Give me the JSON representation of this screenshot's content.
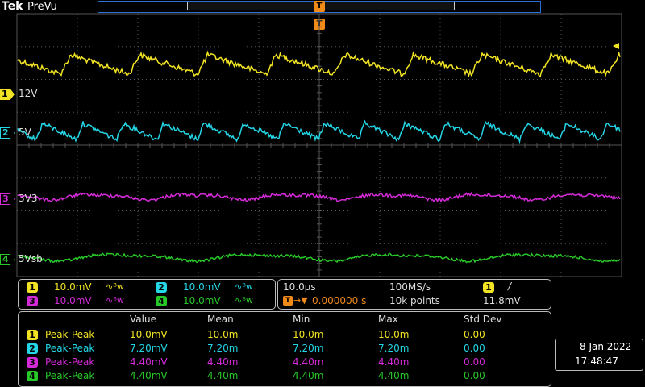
{
  "header": {
    "brand": "Tek",
    "mode": "PreVu",
    "trigger_marker": "T"
  },
  "colors": {
    "ch1": "#f2e424",
    "ch2": "#24d6e6",
    "ch3": "#d42ad8",
    "ch4": "#28c828",
    "trigger": "#f08a18",
    "grid": "#555555"
  },
  "channels": [
    {
      "num": "1",
      "label": "12V",
      "scale": "10.0mV",
      "coupling_icon": "ac-bandwidth-icon"
    },
    {
      "num": "2",
      "label": "5V",
      "scale": "10.0mV",
      "coupling_icon": "ac-bandwidth-icon"
    },
    {
      "num": "3",
      "label": "3V3",
      "scale": "10.0mV",
      "coupling_icon": "ac-bandwidth-icon"
    },
    {
      "num": "4",
      "label": "5Vsb",
      "scale": "10.0mV",
      "coupling_icon": "ac-bandwidth-icon"
    }
  ],
  "coupling_symbol": "∿ᴮw",
  "timebase": {
    "scale": "10.0µs",
    "sample_rate": "100MS/s",
    "trigger_delay": "0.000000 s",
    "record_length": "10k points",
    "trigger_source": "1",
    "trigger_slope": "/",
    "trigger_level": "11.8mV"
  },
  "measurements": {
    "headers": [
      "Value",
      "Mean",
      "Min",
      "Max",
      "Std Dev"
    ],
    "rows": [
      {
        "ch": "1",
        "type": "Peak-Peak",
        "value": "10.0mV",
        "mean": "10.0m",
        "min": "10.0m",
        "max": "10.0m",
        "std": "0.00"
      },
      {
        "ch": "2",
        "type": "Peak-Peak",
        "value": "7.20mV",
        "mean": "7.20m",
        "min": "7.20m",
        "max": "7.20m",
        "std": "0.00"
      },
      {
        "ch": "3",
        "type": "Peak-Peak",
        "value": "4.40mV",
        "mean": "4.40m",
        "min": "4.40m",
        "max": "4.40m",
        "std": "0.00"
      },
      {
        "ch": "4",
        "type": "Peak-Peak",
        "value": "4.40mV",
        "mean": "4.40m",
        "min": "4.40m",
        "max": "4.40m",
        "std": "0.00"
      }
    ]
  },
  "datetime": {
    "date": "8 Jan  2022",
    "time": "17:48:47"
  }
}
